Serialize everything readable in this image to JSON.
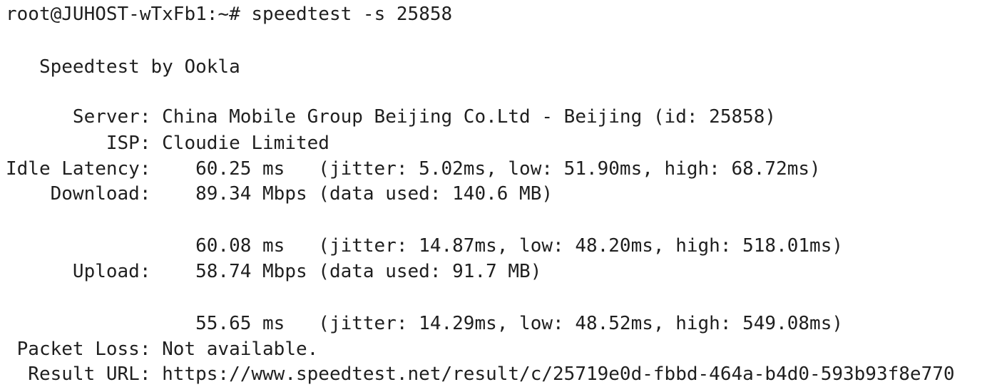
{
  "terminal": {
    "prompt": "root@JUHOST-wTxFb1:~#",
    "command": "speedtest -s 25858",
    "lines": [
      "   Speedtest by Ookla",
      "      Server: China Mobile Group Beijing Co.Ltd - Beijing (id: 25858)",
      "         ISP: Cloudie Limited",
      "Idle Latency:    60.25 ms   (jitter: 5.02ms, low: 51.90ms, high: 68.72ms)",
      "    Download:    89.34 Mbps (data used: 140.6 MB)",
      "                 60.08 ms   (jitter: 14.87ms, low: 48.20ms, high: 518.01ms)",
      "      Upload:    58.74 Mbps (data used: 91.7 MB)",
      "                 55.65 ms   (jitter: 14.29ms, low: 48.52ms, high: 549.08ms)",
      " Packet Loss: Not available.",
      "  Result URL: https://www.speedtest.net/result/c/25719e0d-fbbd-464a-b4d0-593b93f8e770"
    ]
  }
}
